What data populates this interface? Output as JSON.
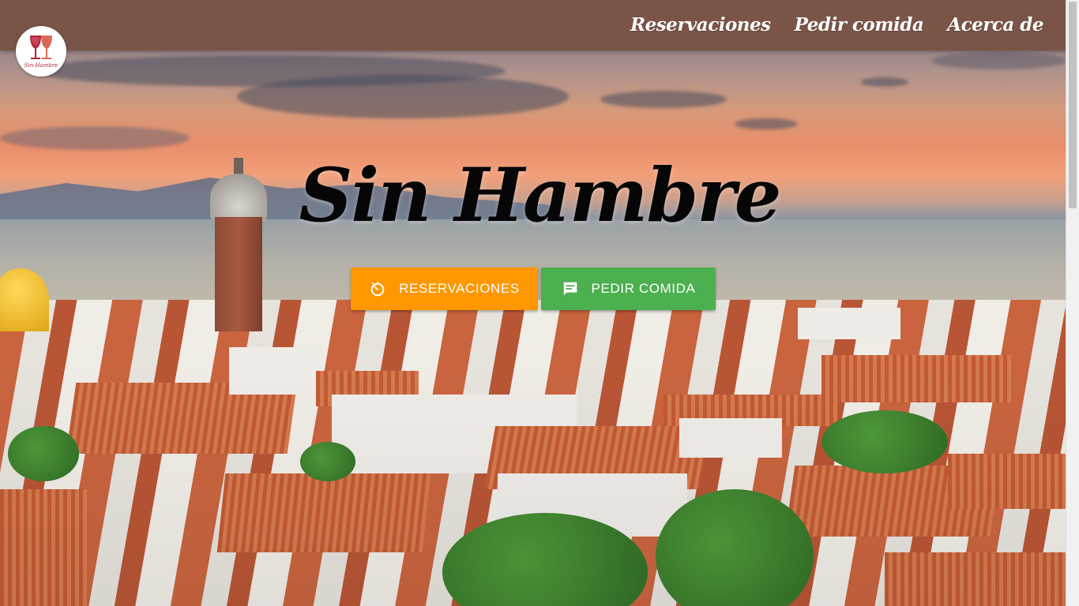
{
  "brand": {
    "logo_text": "Sin Hambre",
    "logo_icon": "wine-glasses-icon"
  },
  "nav": {
    "items": [
      {
        "label": "Reservaciones"
      },
      {
        "label": "Pedir comida"
      },
      {
        "label": "Acerca de"
      }
    ]
  },
  "hero": {
    "title": "Sin Hambre",
    "reserve_button": {
      "label": "RESERVACIONES",
      "icon": "timer-icon",
      "color": "#ff9800"
    },
    "order_button": {
      "label": "PEDIR COMIDA",
      "icon": "chat-message-icon",
      "color": "#4caf50"
    }
  },
  "colors": {
    "header": "#7a5446",
    "title": "#060606"
  }
}
